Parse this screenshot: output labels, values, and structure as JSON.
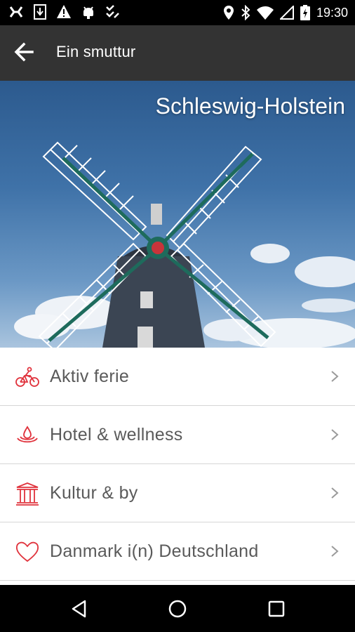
{
  "status_bar": {
    "time": "19:30",
    "left_icons": [
      "usb-debug-icon",
      "download-icon",
      "warning-icon",
      "android-icon",
      "checklist-icon"
    ],
    "right_icons": [
      "location-icon",
      "bluetooth-icon",
      "wifi-icon",
      "signal-icon",
      "battery-charging-icon"
    ]
  },
  "toolbar": {
    "title": "Ein smuttur",
    "back_icon": "arrow-back-icon"
  },
  "hero": {
    "title": "Schleswig-Holstein"
  },
  "menu": {
    "items": [
      {
        "label": "Aktiv ferie",
        "icon": "bicycle-icon"
      },
      {
        "label": "Hotel & wellness",
        "icon": "water-drop-icon"
      },
      {
        "label": "Kultur & by",
        "icon": "museum-icon"
      },
      {
        "label": "Danmark i(n) Deutschland",
        "icon": "heart-icon"
      }
    ]
  },
  "colors": {
    "toolbar": "#333333",
    "accent_icon": "#e0323c",
    "label_text": "#5a5a5a",
    "divider": "#d6d6d6"
  },
  "nav_bar": {
    "buttons": [
      "back-triangle-icon",
      "home-circle-icon",
      "recents-square-icon"
    ]
  }
}
